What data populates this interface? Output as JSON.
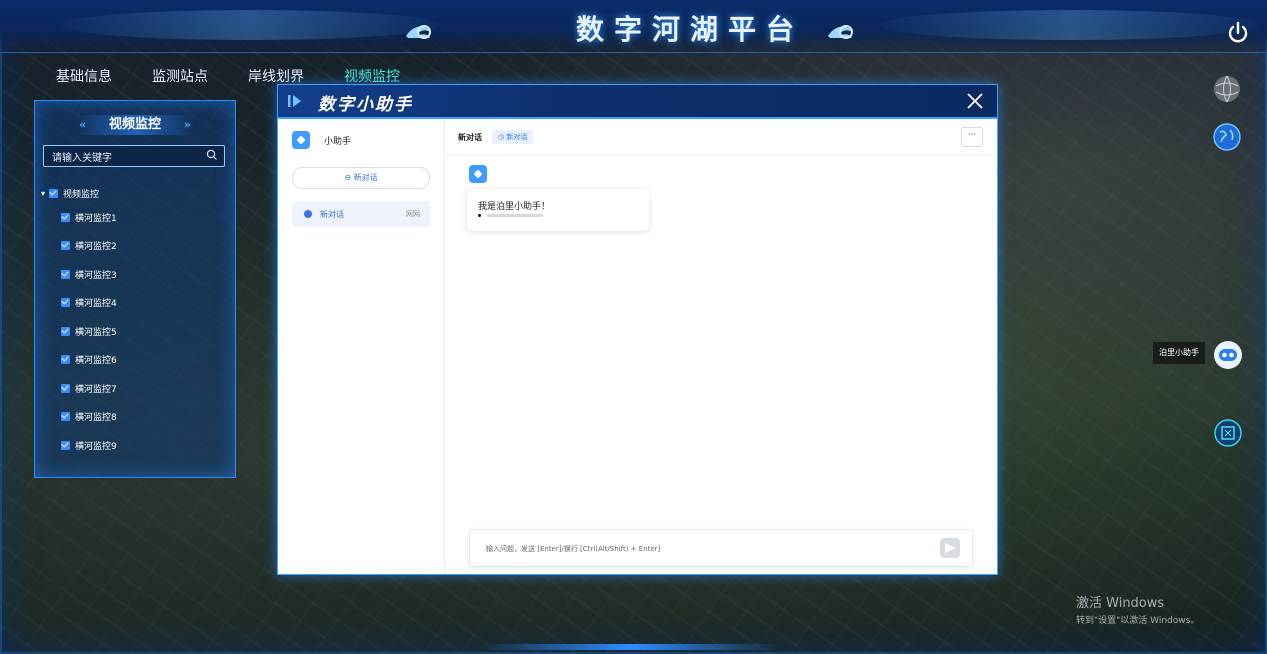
{
  "header": {
    "title": "数字河湖平台"
  },
  "tabs": [
    {
      "label": "基础信息"
    },
    {
      "label": "监测站点"
    },
    {
      "label": "岸线划界"
    },
    {
      "label": "视频监控",
      "active": true
    }
  ],
  "left_panel": {
    "title": "视频监控",
    "search_placeholder": "请输入关键字",
    "tree_root": "视频监控",
    "tree_items": [
      "横河监控1",
      "横河监控2",
      "横河监控3",
      "横河监控4",
      "横河监控5",
      "横河监控6",
      "横河监控7",
      "横河监控8",
      "横河监控9"
    ]
  },
  "right_rail": {
    "assistant_label": "泊里小助手"
  },
  "modal": {
    "title": "数字小助手",
    "sidebar": {
      "brand_name": "小助手",
      "new_chat_label": "新对话",
      "conversation_title": "新对话",
      "conversation_meta": "网网"
    },
    "chat": {
      "header_title": "新对话",
      "header_tag": "新对话",
      "more_label": "···",
      "bot_message": "我是泊里小助手！",
      "input_placeholder": "输入问题，发送 [Enter]/换行 [Ctrl(Alt/Shift) + Enter]"
    }
  },
  "watermark": {
    "line1": "激活 Windows",
    "line2": "转到\"设置\"以激活 Windows。"
  },
  "colors": {
    "accent": "#2a8cff",
    "active_tab": "#47f0d2",
    "chat_blue": "#3a73e8"
  }
}
